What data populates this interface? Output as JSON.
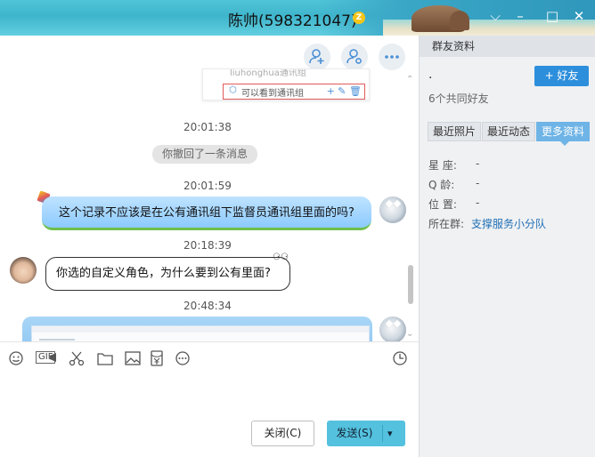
{
  "window": {
    "title": "陈帅(598321047)",
    "vip_badge": "Z"
  },
  "chat": {
    "quote_card": {
      "top_line": "liuhonghua通讯组",
      "row_text": "可以看到通讯组",
      "tools": "+ ✎ 🗑"
    },
    "messages": [
      {
        "type": "time",
        "text": "20:01:38"
      },
      {
        "type": "system",
        "text": "你撤回了一条消息"
      },
      {
        "type": "time",
        "text": "20:01:59"
      },
      {
        "type": "mine",
        "text": "这个记录不应该是在公有通讯组下监督员通讯组里面的吗?"
      },
      {
        "type": "time",
        "text": "20:18:39"
      },
      {
        "type": "theirs",
        "text": "你选的自定义角色，为什么要到公有里面?"
      },
      {
        "type": "time",
        "text": "20:48:34"
      }
    ]
  },
  "toolbar": {
    "gif_label": "GIF",
    "icons": [
      "emoji-icon",
      "gif-icon",
      "screenshot-scissors-icon",
      "folder-icon",
      "image-icon",
      "red-packet-icon",
      "more-icon",
      "history-clock-icon"
    ]
  },
  "buttons": {
    "close": "关闭(C)",
    "send": "发送(S)"
  },
  "panel": {
    "header": "群友资料",
    "name": ".",
    "add_friend": "+ 好友",
    "common_friends": "6个共同好友",
    "tabs": [
      "最近照片",
      "最近动态",
      "更多资料"
    ],
    "active_tab": "更多资料",
    "fields": {
      "zodiac_label": "星 座:",
      "zodiac_value": "-",
      "qage_label": "Q 龄:",
      "qage_value": "-",
      "location_label": "位 置:",
      "location_value": "-",
      "group_label": "所在群:",
      "group_value": "支撑服务小分队"
    }
  },
  "colors": {
    "accent": "#2d8fdc",
    "send_button": "#54c1de",
    "my_bubble": "#9fd3ff",
    "active_tab": "#6fb4e6"
  }
}
